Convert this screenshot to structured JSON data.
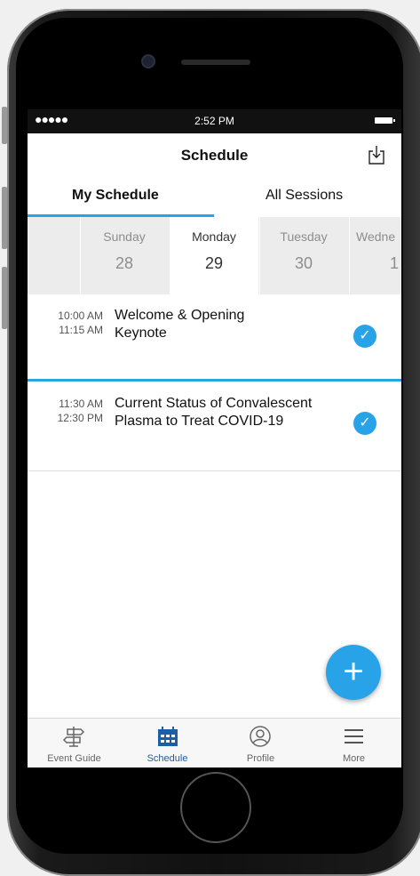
{
  "status_bar": {
    "signal": "●●●●●",
    "time": "2:52 PM"
  },
  "header": {
    "title": "Schedule",
    "export_icon": "export-icon"
  },
  "tabs": [
    {
      "label": "My Schedule",
      "active": true
    },
    {
      "label": "All Sessions",
      "active": false
    }
  ],
  "days": [
    {
      "name": "Sunday",
      "number": "28",
      "selected": false
    },
    {
      "name": "Monday",
      "number": "29",
      "selected": true
    },
    {
      "name": "Tuesday",
      "number": "30",
      "selected": false
    },
    {
      "name": "Wedne",
      "number": "1",
      "selected": false
    }
  ],
  "sessions": [
    {
      "start": "10:00 AM",
      "end": "11:15 AM",
      "title": "Welcome & Opening Keynote",
      "added": true
    },
    {
      "start": "11:30 AM",
      "end": "12:30 PM",
      "title": "Current Status of Convalescent Plasma to Treat COVID-19",
      "added": true
    }
  ],
  "fab": {
    "label": "+"
  },
  "tab_bar": [
    {
      "label": "Event Guide",
      "icon": "signpost-icon",
      "active": false
    },
    {
      "label": "Schedule",
      "icon": "calendar-icon",
      "active": true
    },
    {
      "label": "Profile",
      "icon": "profile-icon",
      "active": false
    },
    {
      "label": "More",
      "icon": "menu-icon",
      "active": false
    }
  ],
  "colors": {
    "accent": "#29a3e8",
    "tab_active": "#1a5fa8",
    "day_strip": "#ececec"
  }
}
